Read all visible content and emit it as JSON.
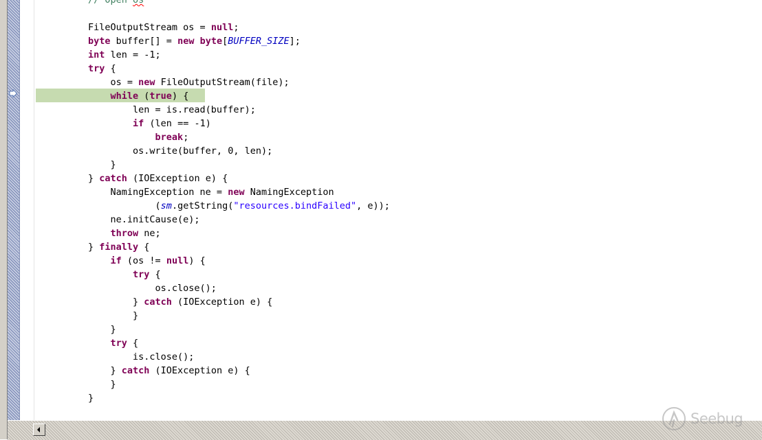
{
  "editor": {
    "lines": [
      {
        "id": "comment-open-os",
        "tokens": [
          {
            "t": "// Open ",
            "c": "cmt"
          },
          {
            "t": "os",
            "c": "cmt squiggle"
          }
        ]
      },
      {
        "id": "blank-1",
        "tokens": []
      },
      {
        "id": "fileoutputstream-decl",
        "tokens": [
          {
            "t": "FileOutputStream os = ",
            "c": ""
          },
          {
            "t": "null",
            "c": "kw"
          },
          {
            "t": ";",
            "c": ""
          }
        ]
      },
      {
        "id": "buffer-decl",
        "tokens": [
          {
            "t": "byte",
            "c": "kw"
          },
          {
            "t": " buffer[] = ",
            "c": ""
          },
          {
            "t": "new",
            "c": "kw"
          },
          {
            "t": " ",
            "c": ""
          },
          {
            "t": "byte",
            "c": "kw"
          },
          {
            "t": "[",
            "c": ""
          },
          {
            "t": "BUFFER_SIZE",
            "c": "const"
          },
          {
            "t": "];",
            "c": ""
          }
        ]
      },
      {
        "id": "len-decl",
        "tokens": [
          {
            "t": "int",
            "c": "kw"
          },
          {
            "t": " len = -1;",
            "c": ""
          }
        ]
      },
      {
        "id": "try-open",
        "tokens": [
          {
            "t": "try",
            "c": "kw"
          },
          {
            "t": " {",
            "c": ""
          }
        ]
      },
      {
        "id": "os-new",
        "tokens": [
          {
            "t": "    os = ",
            "c": ""
          },
          {
            "t": "new",
            "c": "kw"
          },
          {
            "t": " FileOutputStream(file);",
            "c": ""
          }
        ]
      },
      {
        "id": "while-true",
        "tokens": [
          {
            "t": "    ",
            "c": ""
          },
          {
            "t": "while",
            "c": "kw"
          },
          {
            "t": " (",
            "c": ""
          },
          {
            "t": "true",
            "c": "kw"
          },
          {
            "t": ") {",
            "c": ""
          }
        ]
      },
      {
        "id": "len-read",
        "tokens": [
          {
            "t": "        len = is.read(buffer);",
            "c": ""
          }
        ]
      },
      {
        "id": "if-len",
        "tokens": [
          {
            "t": "        ",
            "c": ""
          },
          {
            "t": "if",
            "c": "kw"
          },
          {
            "t": " (len == -1)",
            "c": ""
          }
        ]
      },
      {
        "id": "break",
        "tokens": [
          {
            "t": "            ",
            "c": ""
          },
          {
            "t": "break",
            "c": "kw"
          },
          {
            "t": ";",
            "c": ""
          }
        ]
      },
      {
        "id": "os-write",
        "tokens": [
          {
            "t": "        os.write(buffer, 0, len);",
            "c": ""
          }
        ]
      },
      {
        "id": "while-close",
        "tokens": [
          {
            "t": "    }",
            "c": ""
          }
        ]
      },
      {
        "id": "catch-1",
        "tokens": [
          {
            "t": "} ",
            "c": ""
          },
          {
            "t": "catch",
            "c": "kw"
          },
          {
            "t": " (IOException e) {",
            "c": ""
          }
        ]
      },
      {
        "id": "naming-exception",
        "tokens": [
          {
            "t": "    NamingException ne = ",
            "c": ""
          },
          {
            "t": "new",
            "c": "kw"
          },
          {
            "t": " NamingException",
            "c": ""
          }
        ]
      },
      {
        "id": "sm-getstring",
        "tokens": [
          {
            "t": "            (",
            "c": ""
          },
          {
            "t": "sm",
            "c": "const"
          },
          {
            "t": ".getString(",
            "c": ""
          },
          {
            "t": "\"resources.bindFailed\"",
            "c": "str"
          },
          {
            "t": ", e));",
            "c": ""
          }
        ]
      },
      {
        "id": "init-cause",
        "tokens": [
          {
            "t": "    ne.initCause(e);",
            "c": ""
          }
        ]
      },
      {
        "id": "throw-ne",
        "tokens": [
          {
            "t": "    ",
            "c": ""
          },
          {
            "t": "throw",
            "c": "kw"
          },
          {
            "t": " ne;",
            "c": ""
          }
        ]
      },
      {
        "id": "finally",
        "tokens": [
          {
            "t": "} ",
            "c": ""
          },
          {
            "t": "finally",
            "c": "kw"
          },
          {
            "t": " {",
            "c": ""
          }
        ]
      },
      {
        "id": "if-os-not-null",
        "tokens": [
          {
            "t": "    ",
            "c": ""
          },
          {
            "t": "if",
            "c": "kw"
          },
          {
            "t": " (os != ",
            "c": ""
          },
          {
            "t": "null",
            "c": "kw"
          },
          {
            "t": ") {",
            "c": ""
          }
        ]
      },
      {
        "id": "try-2",
        "tokens": [
          {
            "t": "        ",
            "c": ""
          },
          {
            "t": "try",
            "c": "kw"
          },
          {
            "t": " {",
            "c": ""
          }
        ]
      },
      {
        "id": "os-close",
        "tokens": [
          {
            "t": "            os.close();",
            "c": ""
          }
        ]
      },
      {
        "id": "catch-2",
        "tokens": [
          {
            "t": "        } ",
            "c": ""
          },
          {
            "t": "catch",
            "c": "kw"
          },
          {
            "t": " (IOException e) {",
            "c": ""
          }
        ]
      },
      {
        "id": "catch-2-close",
        "tokens": [
          {
            "t": "        }",
            "c": ""
          }
        ]
      },
      {
        "id": "if-close",
        "tokens": [
          {
            "t": "    }",
            "c": ""
          }
        ]
      },
      {
        "id": "try-3",
        "tokens": [
          {
            "t": "    ",
            "c": ""
          },
          {
            "t": "try",
            "c": "kw"
          },
          {
            "t": " {",
            "c": ""
          }
        ]
      },
      {
        "id": "is-close",
        "tokens": [
          {
            "t": "        is.close();",
            "c": ""
          }
        ]
      },
      {
        "id": "catch-3",
        "tokens": [
          {
            "t": "    } ",
            "c": ""
          },
          {
            "t": "catch",
            "c": "kw"
          },
          {
            "t": " (IOException e) {",
            "c": ""
          }
        ]
      },
      {
        "id": "catch-3-close",
        "tokens": [
          {
            "t": "    }",
            "c": ""
          }
        ]
      },
      {
        "id": "finally-close",
        "tokens": [
          {
            "t": "}",
            "c": ""
          }
        ]
      }
    ],
    "current_line": "while-true"
  },
  "watermark": {
    "text": "Seebug"
  },
  "icons": {
    "debug_marker": "debug-instruction-pointer-icon",
    "scroll_left": "arrow-left-icon",
    "watermark_logo": "seebug-logo-icon"
  },
  "colors": {
    "keyword": "#7f0055",
    "constant": "#0000c0",
    "string": "#2a00ff",
    "comment": "#3f7f5f",
    "current_line_bg": "#c6dbb0",
    "ruler": "#9da9c7"
  }
}
